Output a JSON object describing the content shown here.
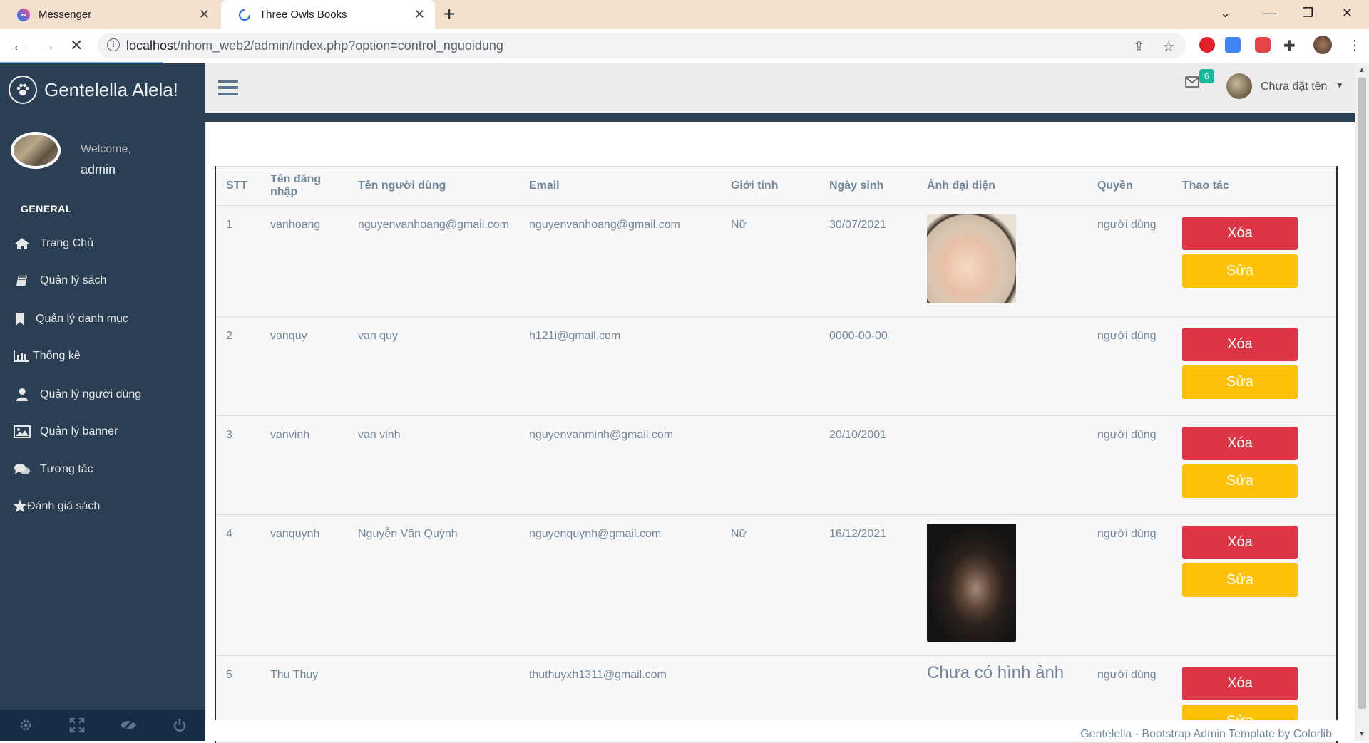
{
  "browser": {
    "tabs": [
      {
        "title": "Messenger"
      },
      {
        "title": "Three Owls Books"
      }
    ],
    "url_host": "localhost",
    "url_path": "/nhom_web2/admin/index.php?option=control_nguoidung"
  },
  "sidebar": {
    "brand": "Gentelella Alela!",
    "welcome": "Welcome,",
    "username": "admin",
    "section": "GENERAL",
    "items": [
      {
        "label": "Trang Chủ",
        "icon": "home-icon"
      },
      {
        "label": "Quản lý sách",
        "icon": "book-icon"
      },
      {
        "label": "Quản lý danh mục",
        "icon": "bookmark-icon"
      },
      {
        "label": "Thống kê",
        "icon": "bar-chart-icon"
      },
      {
        "label": "Quản lý người dùng",
        "icon": "user-icon"
      },
      {
        "label": "Quản lý banner",
        "icon": "image-icon"
      },
      {
        "label": "Tương tác",
        "icon": "comments-icon"
      },
      {
        "label": "Đánh giá sách",
        "icon": "star-icon"
      }
    ]
  },
  "topnav": {
    "mail_count": "6",
    "user_name": "Chưa đặt tên"
  },
  "table": {
    "headers": [
      "STT",
      "Tên đăng nhập",
      "Tên người dùng",
      "Email",
      "Giới tính",
      "Ngày sinh",
      "Ảnh đại diện",
      "Quyền",
      "Thao tác"
    ],
    "delete_label": "Xóa",
    "edit_label": "Sửa",
    "no_image": "Chưa có hình ảnh",
    "rows": [
      {
        "stt": "1",
        "login": "vanhoang",
        "name": "nguyenvanhoang@gmail.com",
        "email": "nguyenvanhoang@gmail.com",
        "gender": "Nữ",
        "dob": "30/07/2021",
        "role": "người dùng"
      },
      {
        "stt": "2",
        "login": "vanquy",
        "name": "van quy",
        "email": "h121i@gmail.com",
        "gender": "",
        "dob": "0000-00-00",
        "role": "người dùng"
      },
      {
        "stt": "3",
        "login": "vanvinh",
        "name": "van vinh",
        "email": "nguyenvanminh@gmail.com",
        "gender": "",
        "dob": "20/10/2001",
        "role": "người dùng"
      },
      {
        "stt": "4",
        "login": "vanquynh",
        "name": "Nguyễn Văn Quỳnh",
        "email": "nguyenquynh@gmail.com",
        "gender": "Nữ",
        "dob": "16/12/2021",
        "role": "người dùng"
      },
      {
        "stt": "5",
        "login": "Thu Thuy",
        "name": "",
        "email": "thuthuyxh1311@gmail.com",
        "gender": "",
        "dob": "",
        "role": "người dùng"
      }
    ]
  },
  "footer": "Gentelella - Bootstrap Admin Template by Colorlib",
  "colors": {
    "sidebar": "#2a3f54",
    "delete": "#dc3545",
    "edit": "#ffc107",
    "badge": "#1abb9c"
  }
}
